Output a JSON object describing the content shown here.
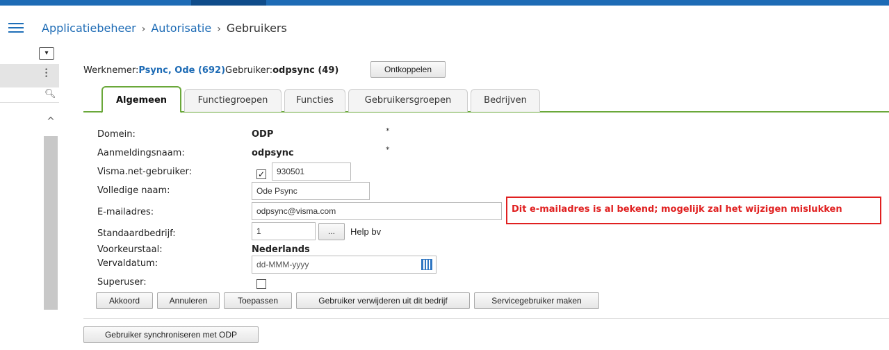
{
  "header": {
    "menu_icon": "hamburger-icon",
    "breadcrumb": [
      "Applicatiebeheer",
      "Autorisatie",
      "Gebruikers"
    ],
    "separator": "›"
  },
  "sidebar": {
    "collapse_icon": "chevron-down-icon",
    "more_icon": "vertical-dots-icon",
    "search_icon": "search-icon",
    "scroll_up_icon": "chevron-up-icon"
  },
  "employee": {
    "werknemer_label": "Werknemer:",
    "werknemer_value": "Psync, Ode (692)",
    "gebruiker_label": "Gebruiker:",
    "gebruiker_value": "odpsync (49)",
    "unlink_label": "Ontkoppelen"
  },
  "tabs": [
    {
      "label": "Algemeen",
      "active": true
    },
    {
      "label": "Functiegroepen",
      "active": false
    },
    {
      "label": "Functies",
      "active": false
    },
    {
      "label": "Gebruikersgroepen",
      "active": false
    },
    {
      "label": "Bedrijven",
      "active": false
    }
  ],
  "form": {
    "domein_label": "Domein:",
    "domein_value": "ODP",
    "aanmeld_label": "Aanmeldingsnaam:",
    "aanmeld_value": "odpsync",
    "required_marker": "*",
    "visma_label": "Visma.net-gebruiker:",
    "visma_checked": true,
    "visma_value": "930501",
    "naam_label": "Volledige naam:",
    "naam_value": "Ode Psync",
    "email_label": "E-mailadres:",
    "email_value": "odpsync@visma.com",
    "email_error": "Dit e-mailadres is al bekend; mogelijk zal het wijzigen mislukken",
    "bedrijf_label": "Standaardbedrijf:",
    "bedrijf_value": "1",
    "bedrijf_lookup": "...",
    "bedrijf_name": "Help bv",
    "taal_label": "Voorkeurstaal:",
    "taal_value": "Nederlands",
    "verval_label": "Vervaldatum:",
    "verval_placeholder": "dd-MMM-yyyy",
    "calendar_icon": "calendar-icon",
    "super_label": "Superuser:",
    "super_checked": false
  },
  "actions": {
    "akkoord": "Akkoord",
    "annuleren": "Annuleren",
    "toepassen": "Toepassen",
    "verwijderen": "Gebruiker verwijderen uit dit bedrijf",
    "service": "Servicegebruiker maken",
    "sync": "Gebruiker synchroniseren met ODP"
  },
  "colors": {
    "brand_blue": "#1d6bb5",
    "tab_green": "#6aa83a",
    "error_red": "#e02020"
  }
}
